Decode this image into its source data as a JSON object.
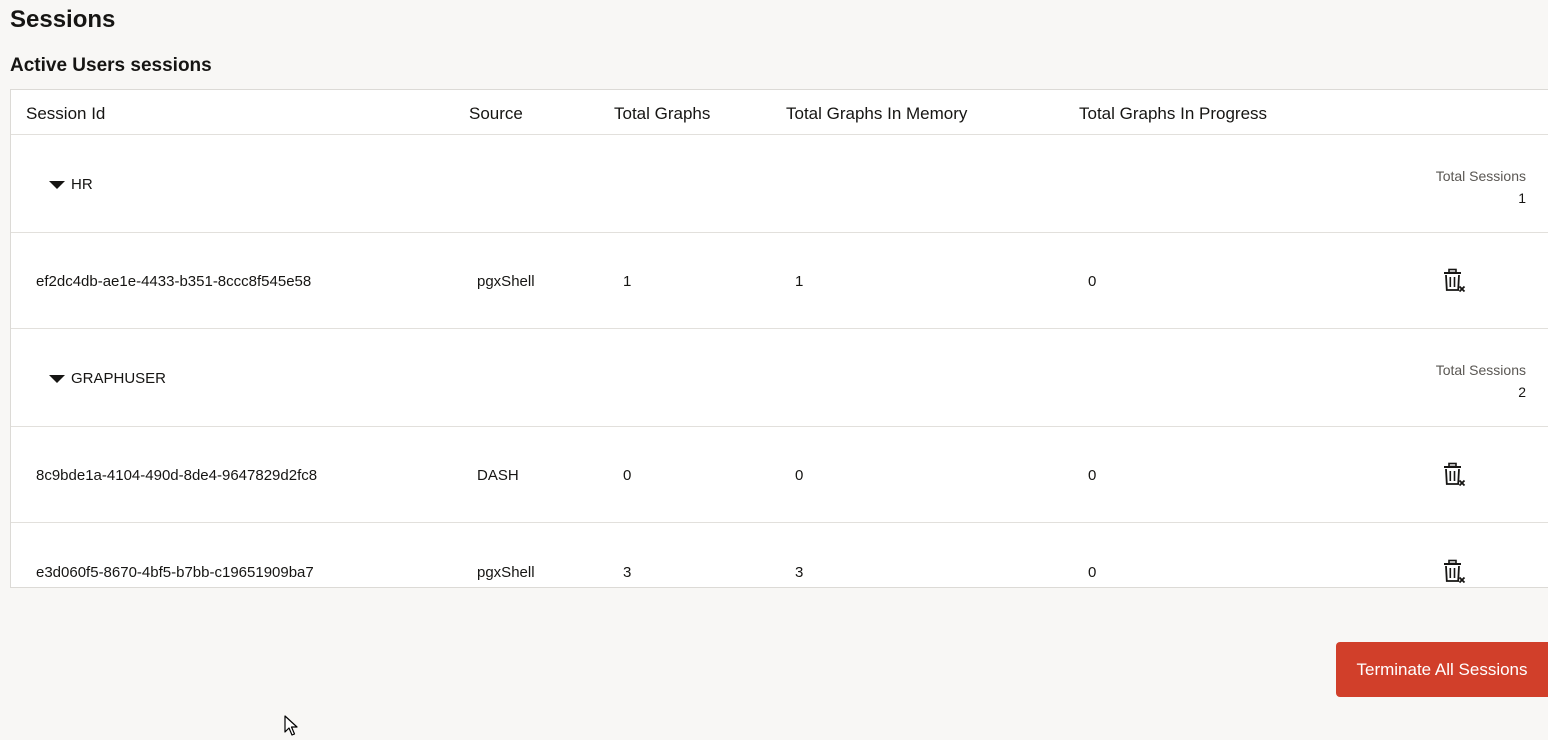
{
  "page": {
    "title": "Sessions",
    "section_title": "Active Users sessions"
  },
  "table": {
    "columns": [
      "Session Id",
      "Source",
      "Total Graphs",
      "Total Graphs In Memory",
      "Total Graphs In Progress"
    ],
    "groups": [
      {
        "name": "HR",
        "total_label": "Total Sessions",
        "total_value": "1",
        "expanded": true,
        "rows": [
          {
            "session_id": "ef2dc4db-ae1e-4433-b351-8ccc8f545e58",
            "source": "pgxShell",
            "total_graphs": "1",
            "in_memory": "1",
            "in_progress": "0"
          }
        ]
      },
      {
        "name": "GRAPHUSER",
        "total_label": "Total Sessions",
        "total_value": "2",
        "expanded": true,
        "rows": [
          {
            "session_id": "8c9bde1a-4104-490d-8de4-9647829d2fc8",
            "source": "DASH",
            "total_graphs": "0",
            "in_memory": "0",
            "in_progress": "0"
          },
          {
            "session_id": "e3d060f5-8670-4bf5-b7bb-c19651909ba7",
            "source": "pgxShell",
            "total_graphs": "3",
            "in_memory": "3",
            "in_progress": "0"
          }
        ]
      }
    ],
    "row_action_icon": "delete-session-icon"
  },
  "actions": {
    "terminate_all_label": "Terminate All Sessions",
    "terminate_color": "#d13f2a"
  }
}
